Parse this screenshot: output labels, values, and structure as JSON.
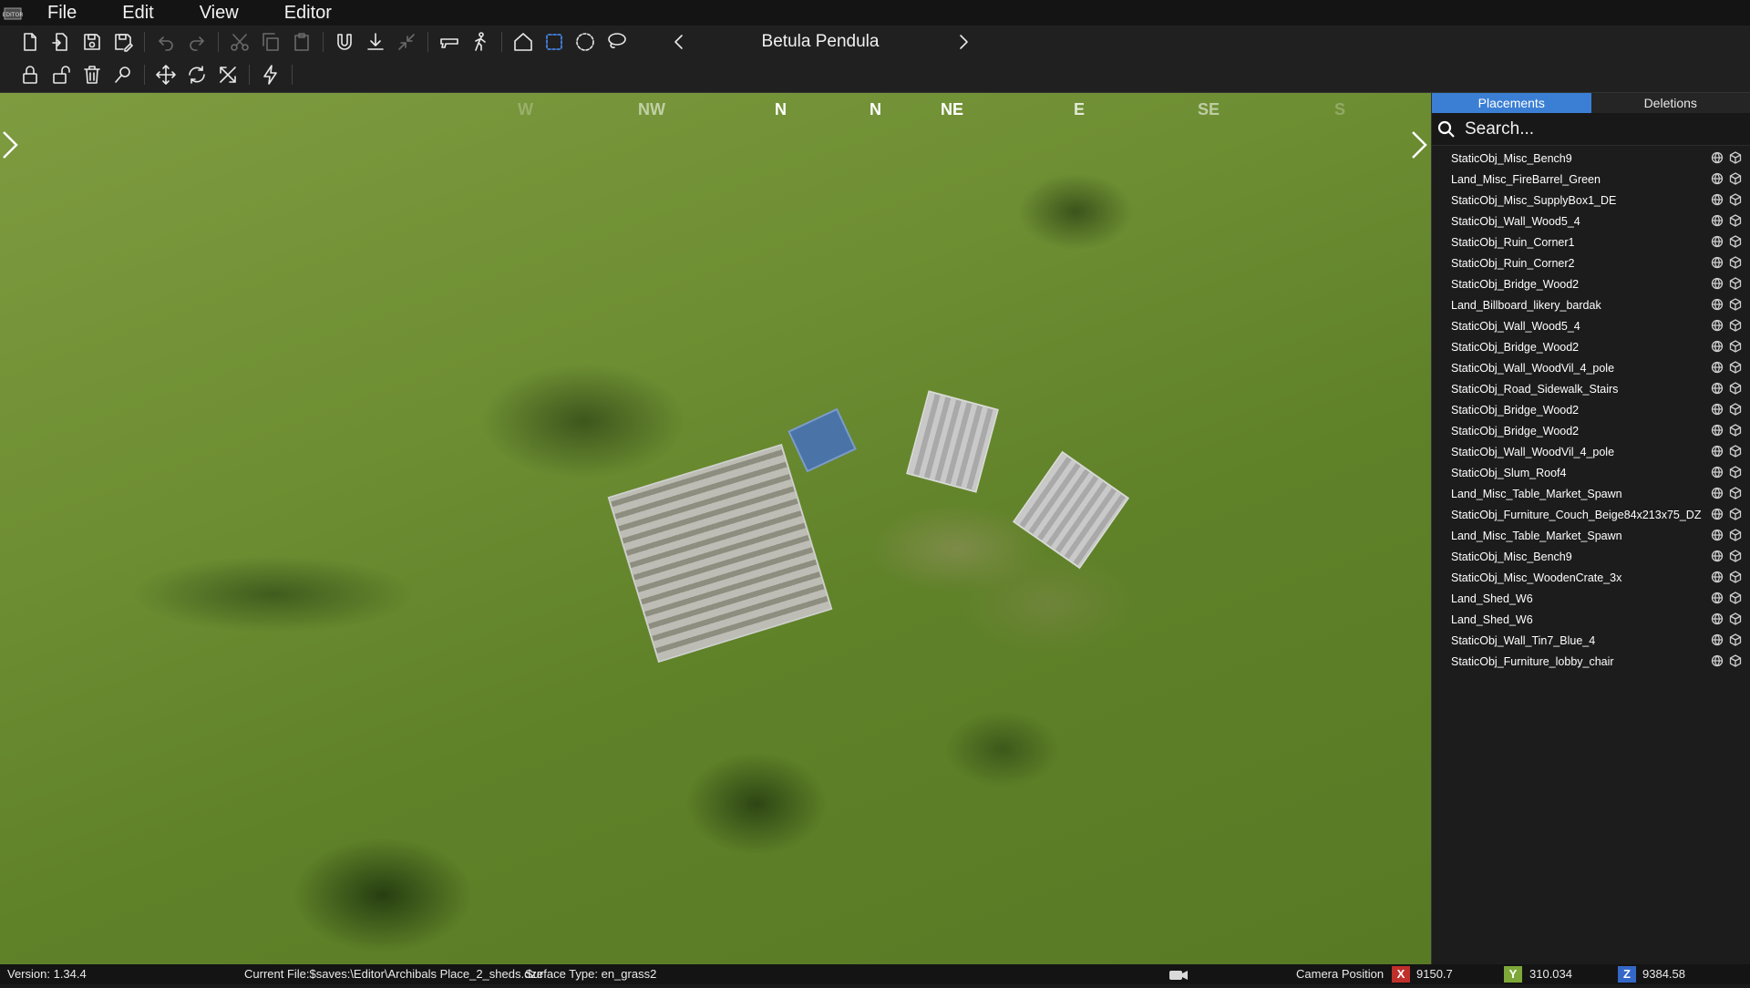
{
  "menu": {
    "items": [
      "File",
      "Edit",
      "View",
      "Editor"
    ]
  },
  "toolbar": {
    "preset_name": "Betula Pendula"
  },
  "compass": {
    "labels": [
      {
        "text": "W",
        "opacity": 0.25
      },
      {
        "text": "NW",
        "opacity": 0.55
      },
      {
        "text": "N",
        "opacity": 1
      },
      {
        "text": "N",
        "opacity": 1
      },
      {
        "text": "NE",
        "opacity": 1
      },
      {
        "text": "E",
        "opacity": 0.8
      },
      {
        "text": "SE",
        "opacity": 0.55
      },
      {
        "text": "S",
        "opacity": 0.25
      }
    ]
  },
  "panel": {
    "tabs": [
      "Placements",
      "Deletions"
    ],
    "active_tab": "Placements",
    "search_placeholder": "Search...",
    "items": [
      "StaticObj_Misc_Bench9",
      "Land_Misc_FireBarrel_Green",
      "StaticObj_Misc_SupplyBox1_DE",
      "StaticObj_Wall_Wood5_4",
      "StaticObj_Ruin_Corner1",
      "StaticObj_Ruin_Corner2",
      "StaticObj_Bridge_Wood2",
      "Land_Billboard_likery_bardak",
      "StaticObj_Wall_Wood5_4",
      "StaticObj_Bridge_Wood2",
      "StaticObj_Wall_WoodVil_4_pole",
      "StaticObj_Road_Sidewalk_Stairs",
      "StaticObj_Bridge_Wood2",
      "StaticObj_Bridge_Wood2",
      "StaticObj_Wall_WoodVil_4_pole",
      "StaticObj_Slum_Roof4",
      "Land_Misc_Table_Market_Spawn",
      "StaticObj_Furniture_Couch_Beige84x213x75_DZ",
      "Land_Misc_Table_Market_Spawn",
      "StaticObj_Misc_Bench9",
      "StaticObj_Misc_WoodenCrate_3x",
      "Land_Shed_W6",
      "Land_Shed_W6",
      "StaticObj_Wall_Tin7_Blue_4",
      "StaticObj_Furniture_lobby_chair"
    ]
  },
  "status": {
    "version": "Version:  1.34.4",
    "current_file": "Current File:$saves:\\Editor\\Archibals Place_2_sheds.dze",
    "surface_type": "Surface Type: en_grass2",
    "camera_label": "Camera Position",
    "x_label": "X",
    "x_value": "9150.7",
    "y_label": "Y",
    "y_value": "310.034",
    "z_label": "Z",
    "z_value": "9384.58",
    "colors": {
      "x": "#c0302b",
      "y": "#7ea83a",
      "z": "#3468c8"
    }
  }
}
